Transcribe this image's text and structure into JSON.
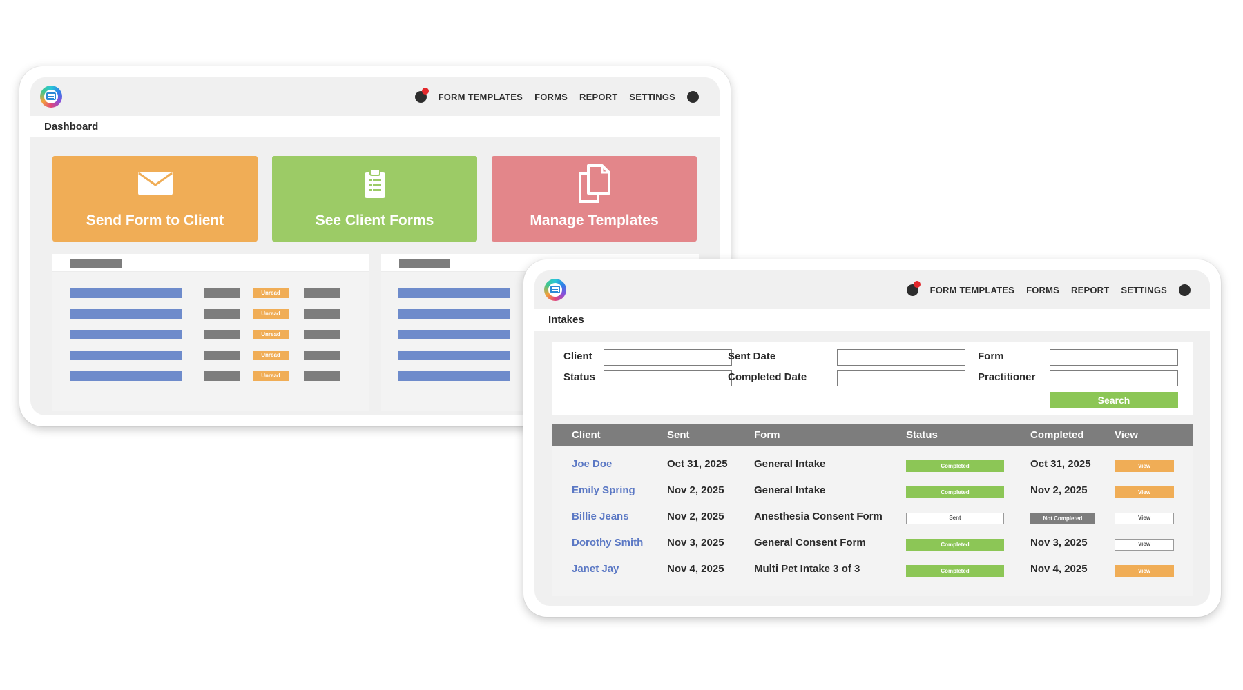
{
  "dashboard": {
    "nav": [
      "FORM TEMPLATES",
      "FORMS",
      "REPORT",
      "SETTINGS"
    ],
    "page_title": "Dashboard",
    "tiles": [
      {
        "label": "Send Form to Client",
        "icon": "envelope-icon",
        "color": "#f0ad56"
      },
      {
        "label": "See Client Forms",
        "icon": "clipboard-icon",
        "color": "#9ccb66"
      },
      {
        "label": "Manage Templates",
        "icon": "copy-icon",
        "color": "#e3868a"
      }
    ],
    "unread_label": "Unread"
  },
  "intakes": {
    "nav": [
      "FORM TEMPLATES",
      "FORMS",
      "REPORT",
      "SETTINGS"
    ],
    "page_title": "Intakes",
    "filters": {
      "client": "Client",
      "sent_date": "Sent Date",
      "form": "Form",
      "status": "Status",
      "completed_date": "Completed Date",
      "practitioner": "Practitioner",
      "search_button": "Search"
    },
    "columns": [
      "Client",
      "Sent",
      "Form",
      "Status",
      "Completed",
      "View"
    ],
    "rows": [
      {
        "client": "Joe Doe",
        "sent": "Oct 31, 2025",
        "form": "General Intake",
        "status": "Completed",
        "completed": "Oct 31, 2025",
        "view": "View"
      },
      {
        "client": "Emily Spring",
        "sent": "Nov 2, 2025",
        "form": "General Intake",
        "status": "Completed",
        "completed": "Nov 2, 2025",
        "view": "View"
      },
      {
        "client": "Billie Jeans",
        "sent": "Nov 2, 2025",
        "form": "Anesthesia Consent Form",
        "status": "Sent",
        "completed": "Not Completed",
        "view": "View"
      },
      {
        "client": "Dorothy Smith",
        "sent": "Nov 3, 2025",
        "form": "General Consent Form",
        "status": "Completed",
        "completed": "Nov 3, 2025",
        "view": "View"
      },
      {
        "client": "Janet Jay",
        "sent": "Nov 4, 2025",
        "form": "Multi Pet Intake 3 of 3",
        "status": "Completed",
        "completed": "Nov 4, 2025",
        "view": "View"
      }
    ]
  },
  "colors": {
    "accent_orange": "#f0ad56",
    "accent_green": "#8cc656",
    "accent_red": "#e3868a",
    "link_blue": "#5b78c4",
    "header_gray": "#7d7d7d",
    "notification_red": "#e3282c"
  }
}
